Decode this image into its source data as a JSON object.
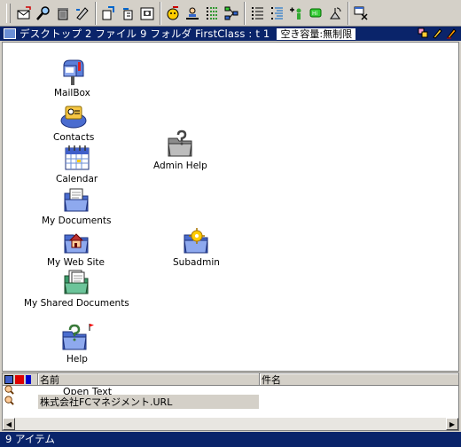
{
  "toolbar": {
    "groups": [
      [
        "new-message-icon",
        "search-icon",
        "trash-icon",
        "pen-icon"
      ],
      [
        "send-icon",
        "reply-icon",
        "print-icon"
      ],
      [
        "user-share-icon",
        "user-info-icon",
        "list-icon",
        "network-icon"
      ],
      [
        "list-view-icon",
        "tree-view-icon",
        "add-user-icon",
        "chat-icon",
        "satellite-icon"
      ],
      [
        "close-window-icon"
      ]
    ]
  },
  "window": {
    "title": "デスクトップ  2 ファイル 9 フォルダ   FirstClass : t 1",
    "quota": "空き容量:無制限"
  },
  "desktop": {
    "icons": [
      {
        "label": "MailBox",
        "icon": "mailbox-icon"
      },
      {
        "label": "Contacts",
        "icon": "contacts-icon"
      },
      {
        "label": "Admin Help",
        "icon": "admin-help-icon"
      },
      {
        "label": "Calendar",
        "icon": "calendar-icon"
      },
      {
        "label": "My Documents",
        "icon": "my-documents-icon"
      },
      {
        "label": "My Web Site",
        "icon": "my-web-site-icon"
      },
      {
        "label": "Subadmin",
        "icon": "subadmin-icon"
      },
      {
        "label": "My Shared Documents",
        "icon": "shared-documents-icon"
      },
      {
        "label": "Help",
        "icon": "help-icon"
      }
    ]
  },
  "list": {
    "columns": {
      "name": "名前",
      "subject": "件名"
    },
    "rows": [
      {
        "name": "Open Text",
        "subject": ""
      },
      {
        "name": "株式会社FCマネジメント.URL",
        "subject": ""
      }
    ]
  },
  "status": {
    "text": "9 アイテム"
  }
}
